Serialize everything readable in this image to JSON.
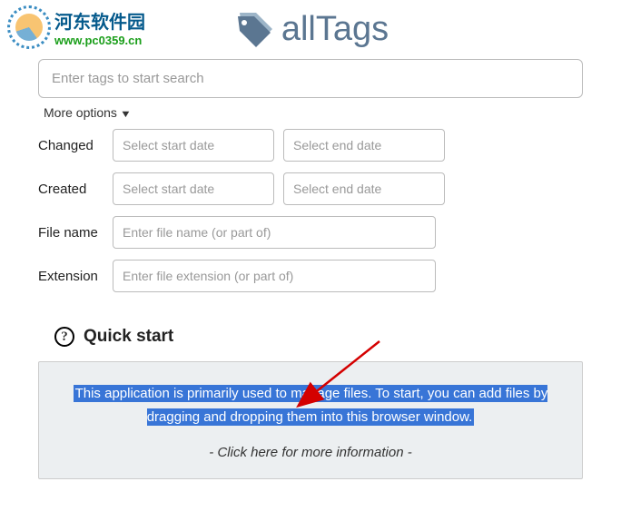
{
  "watermark": {
    "cn": "河东软件园",
    "url": "www.pc0359.cn"
  },
  "brand": {
    "name": "allTags"
  },
  "search": {
    "placeholder": "Enter tags to start search"
  },
  "more_options_label": "More options",
  "filters": {
    "changed": {
      "label": "Changed",
      "start": "Select start date",
      "end": "Select end date"
    },
    "created": {
      "label": "Created",
      "start": "Select start date",
      "end": "Select end date"
    },
    "filename": {
      "label": "File name",
      "placeholder": "Enter file name (or part of)"
    },
    "extension": {
      "label": "Extension",
      "placeholder": "Enter file extension (or part of)"
    }
  },
  "quickstart": {
    "title": "Quick start",
    "desc": "This application is primarily used to manage files. To start, you can add files by dragging and dropping them into this browser window.",
    "more": "- Click here for more information -"
  }
}
